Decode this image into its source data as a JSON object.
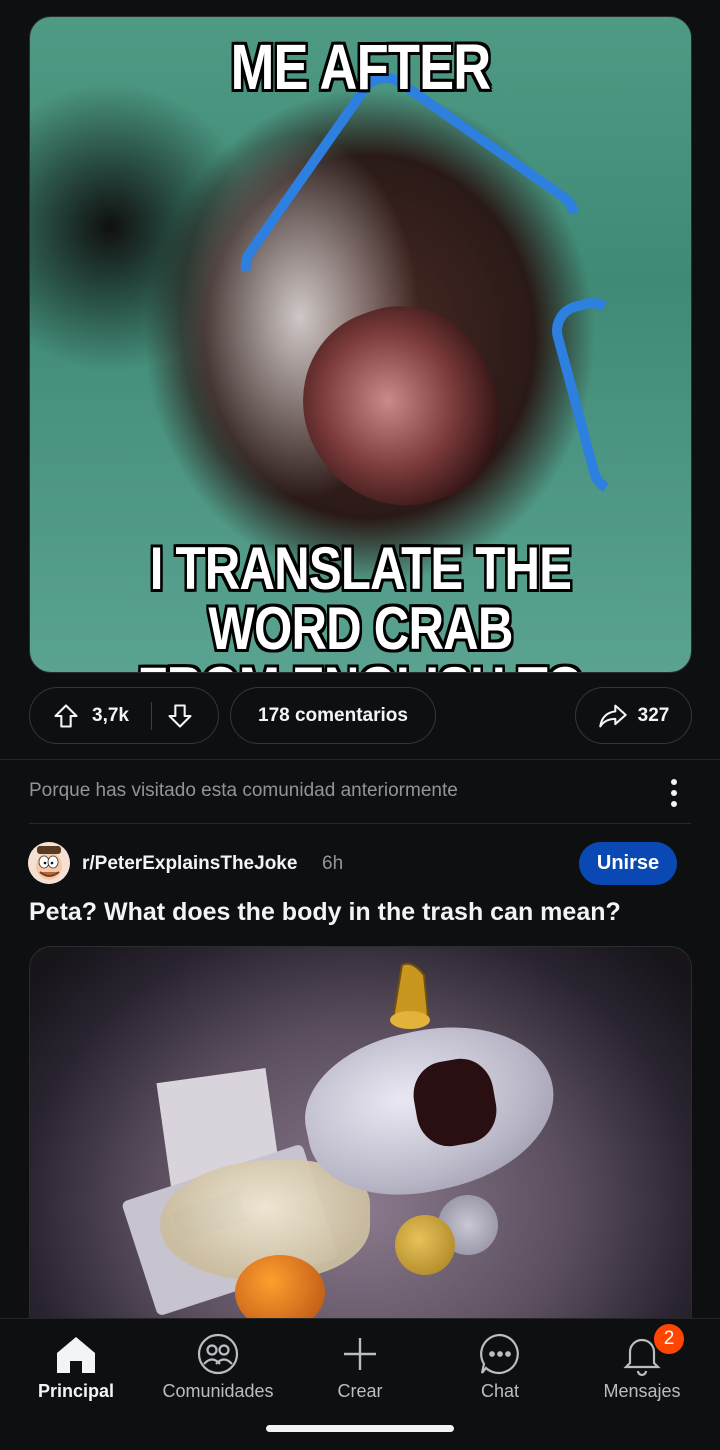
{
  "post1": {
    "meme_top_text": "ME AFTER",
    "meme_bottom_line1": "I TRANSLATE THE WORD CRAB",
    "meme_bottom_line2": "FROM ENGLISH TO JAPANESE",
    "upvotes": "3,7k",
    "comments": "178 comentarios",
    "shares": "327"
  },
  "recommendation": {
    "reason": "Porque has visitado esta comunidad anteriormente"
  },
  "post2": {
    "subreddit": "r/PeterExplainsTheJoke",
    "age": "6h",
    "join_label": "Unirse",
    "title": "Peta? What does the body in the trash can mean?"
  },
  "bottom_nav": {
    "items": [
      {
        "label": "Principal",
        "icon": "home-icon",
        "active": true
      },
      {
        "label": "Comunidades",
        "icon": "communities-icon"
      },
      {
        "label": "Crear",
        "icon": "plus-icon"
      },
      {
        "label": "Chat",
        "icon": "chat-icon"
      },
      {
        "label": "Mensajes",
        "icon": "bell-icon"
      }
    ],
    "messages_badge": "2"
  },
  "colors": {
    "background": "#0e0f10",
    "join_button": "#0a49b4",
    "badge": "#ff4500"
  }
}
